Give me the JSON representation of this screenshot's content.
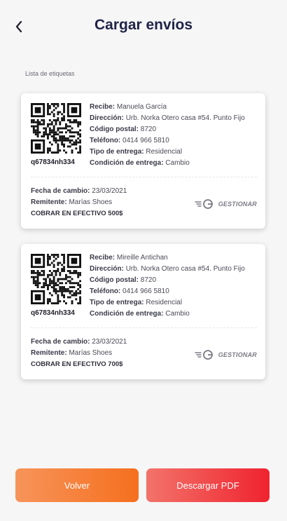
{
  "header": {
    "title": "Cargar envíos",
    "back_icon": "chevron-left-icon"
  },
  "section_label": "Lista de etiquetas",
  "labels": [
    {
      "tracking_code": "q67834nh334",
      "fields": [
        {
          "label": "Recibe:",
          "value": "Manuela García"
        },
        {
          "label": "Dirección:",
          "value": "Urb. Norka Otero casa #54. Punto Fijo"
        },
        {
          "label": "Código postal:",
          "value": "8720"
        },
        {
          "label": "Teléfono:",
          "value": "0414 966 5810"
        },
        {
          "label": "Tipo de entrega:",
          "value": "Residencial"
        },
        {
          "label": "Condición de entrega:",
          "value": "Cambio"
        }
      ],
      "footer": [
        {
          "label": "Fecha de cambio:",
          "value": "23/03/2021"
        },
        {
          "label": "Remitente:",
          "value": "Marías Shoes"
        }
      ],
      "amount": "COBRAR EN EFECTIVO 500$",
      "brand": "GESTIONAR"
    },
    {
      "tracking_code": "q67834nh334",
      "fields": [
        {
          "label": "Recibe:",
          "value": "Mireille Antichan"
        },
        {
          "label": "Dirección:",
          "value": "Urb. Norka Otero casa #54. Punto Fijo"
        },
        {
          "label": "Código postal:",
          "value": "8720"
        },
        {
          "label": "Teléfono:",
          "value": "0414 966 5810"
        },
        {
          "label": "Tipo de entrega:",
          "value": "Residencial"
        },
        {
          "label": "Condición de entrega:",
          "value": "Cambio"
        }
      ],
      "footer": [
        {
          "label": "Fecha de cambio:",
          "value": "23/03/2021"
        },
        {
          "label": "Remitente:",
          "value": "Marías Shoes"
        }
      ],
      "amount": "COBRAR EN EFECTIVO 700$",
      "brand": "GESTIONAR"
    }
  ],
  "buttons": {
    "back_label": "Volver",
    "download_label": "Descargar PDF"
  },
  "colors": {
    "title": "#1f2347",
    "back_button": "#f56f1e",
    "download_button": "#f0232f"
  }
}
